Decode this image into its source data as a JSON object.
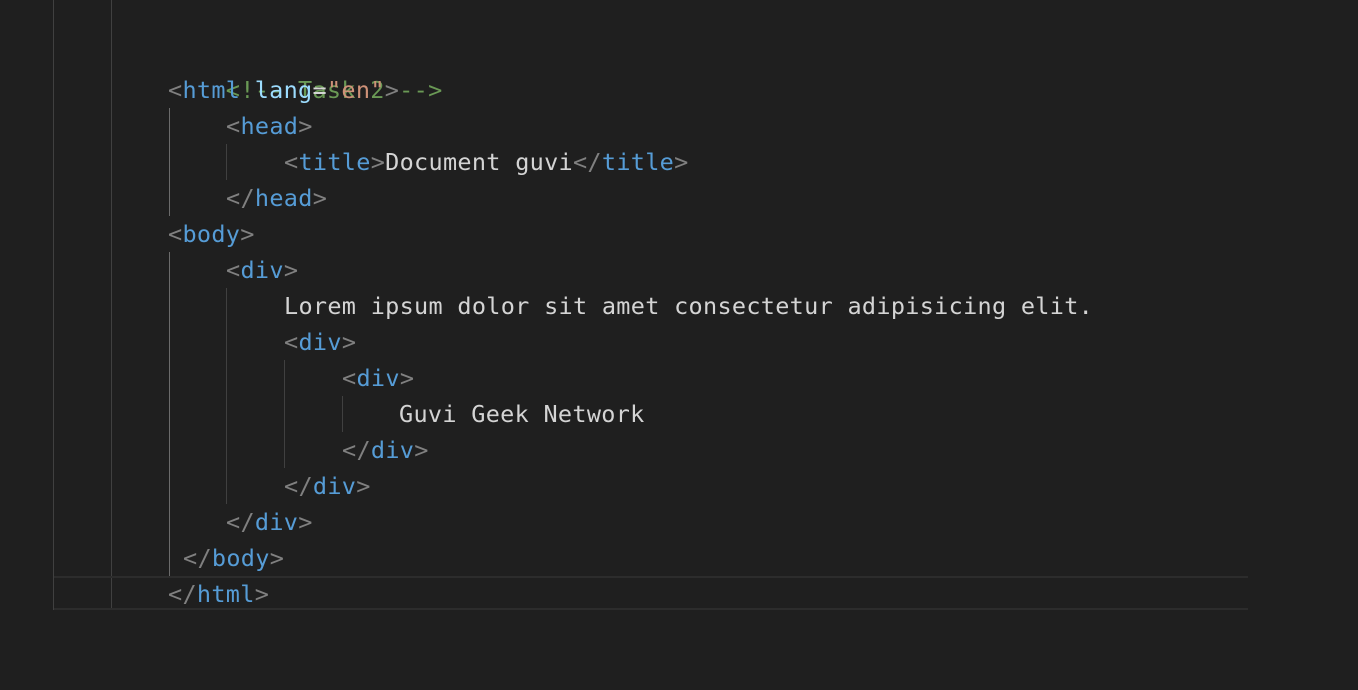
{
  "editor": {
    "lines": [
      {
        "comment": "<!-- Task 2 -->"
      },
      {
        "open": "<",
        "tag": "html",
        "attr": "lang",
        "eq": "=",
        "q1": "\"",
        "val": "en",
        "q2": "\"",
        "close": ">"
      },
      {
        "open": "<",
        "tag": "head",
        "close": ">"
      },
      {
        "open": "<",
        "tag": "title",
        "close": ">",
        "text": "Document guvi",
        "endopen": "</",
        "endtag": "title",
        "endclose": ">"
      },
      {
        "open": "</",
        "tag": "head",
        "close": ">"
      },
      {
        "open": "<",
        "tag": "body",
        "close": ">"
      },
      {
        "open": "<",
        "tag": "div",
        "close": ">"
      },
      {
        "text": "Lorem ipsum dolor sit amet consectetur adipisicing elit."
      },
      {
        "open": "<",
        "tag": "div",
        "close": ">"
      },
      {
        "open": "<",
        "tag": "div",
        "close": ">"
      },
      {
        "text": "Guvi Geek Network"
      },
      {
        "open": "</",
        "tag": "div",
        "close": ">"
      },
      {
        "open": "</",
        "tag": "div",
        "close": ">"
      },
      {
        "open": "</",
        "tag": "div",
        "close": ">"
      },
      {
        "open": "</",
        "tag": "body",
        "close": ">"
      },
      {
        "open": "</",
        "tag": "html",
        "close": ">"
      }
    ]
  }
}
